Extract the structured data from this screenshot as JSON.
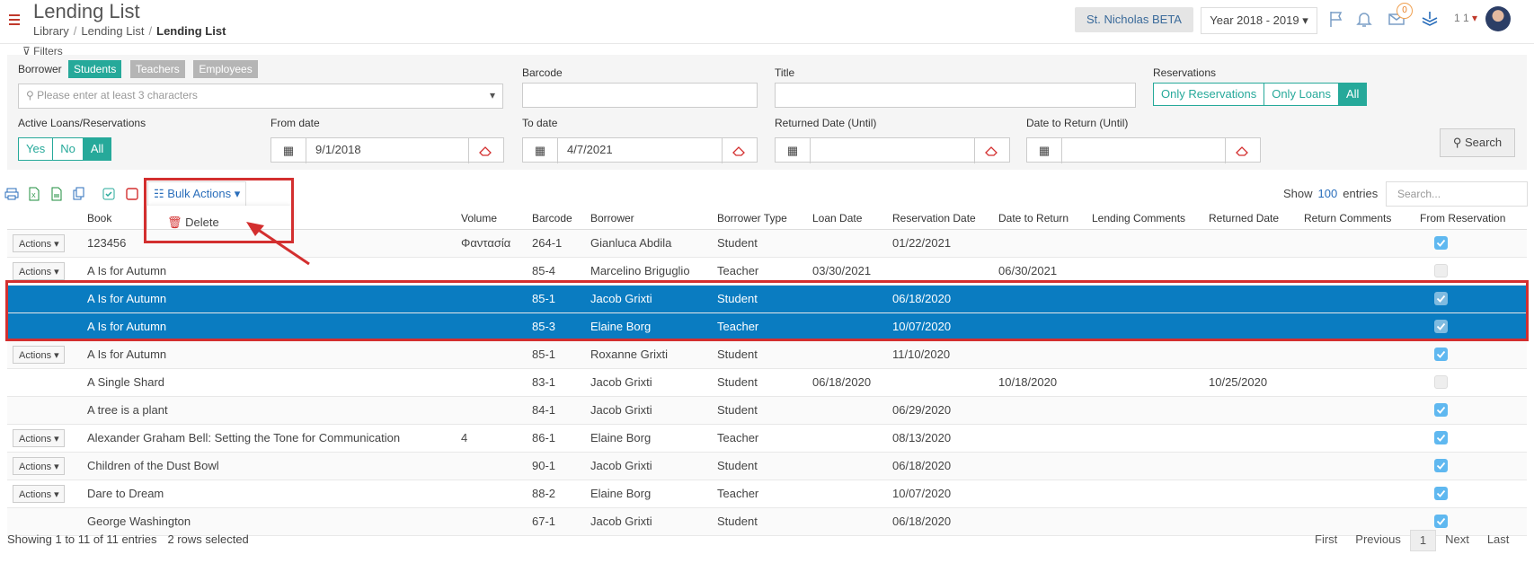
{
  "header": {
    "title": "Lending List",
    "breadcrumb": [
      "Library",
      "Lending List",
      "Lending List"
    ],
    "school": "St. Nicholas BETA",
    "year": "Year 2018 - 2019",
    "notification_count": "0",
    "user": "1 1"
  },
  "filters": {
    "label": "Filters",
    "borrower_label": "Borrower",
    "borrower_types": [
      "Students",
      "Teachers",
      "Employees"
    ],
    "borrower_placeholder": "Please enter at least 3 characters",
    "barcode_label": "Barcode",
    "title_label": "Title",
    "reservations_label": "Reservations",
    "reservations_options": [
      "Only Reservations",
      "Only Loans",
      "All"
    ],
    "active_label": "Active Loans/Reservations",
    "active_options": [
      "Yes",
      "No",
      "All"
    ],
    "from_date_label": "From date",
    "from_date": "9/1/2018",
    "to_date_label": "To date",
    "to_date": "4/7/2021",
    "returned_date_label": "Returned Date (Until)",
    "date_to_return_label": "Date to Return (Until)",
    "search_label": "Search"
  },
  "toolbar": {
    "bulk_label": "Bulk Actions",
    "delete_label": "Delete",
    "show_label": "Show",
    "show_count": "100",
    "entries_label": "entries",
    "search_placeholder": "Search..."
  },
  "table": {
    "columns": [
      "Book",
      "Volume",
      "Barcode",
      "Borrower",
      "Borrower Type",
      "Loan Date",
      "Reservation Date",
      "Date to Return",
      "Lending Comments",
      "Returned Date",
      "Return Comments",
      "From Reservation"
    ],
    "action_label": "Actions",
    "rows": [
      {
        "actions": true,
        "book": "123456",
        "volume": "Φαντασία",
        "barcode": "264-1",
        "borrower": "Gianluca Abdila",
        "type": "Student",
        "loan": "",
        "reservation": "01/22/2021",
        "to_return": "",
        "returned": "",
        "from_res": true,
        "selected": false
      },
      {
        "actions": true,
        "book": "A Is for Autumn",
        "volume": "",
        "barcode": "85-4",
        "borrower": "Marcelino Briguglio",
        "type": "Teacher",
        "loan": "03/30/2021",
        "reservation": "",
        "to_return": "06/30/2021",
        "returned": "",
        "from_res": false,
        "selected": false
      },
      {
        "actions": false,
        "book": "A Is for Autumn",
        "volume": "",
        "barcode": "85-1",
        "borrower": "Jacob Grixti",
        "type": "Student",
        "loan": "",
        "reservation": "06/18/2020",
        "to_return": "",
        "returned": "",
        "from_res": true,
        "selected": true
      },
      {
        "actions": false,
        "book": "A Is for Autumn",
        "volume": "",
        "barcode": "85-3",
        "borrower": "Elaine Borg",
        "type": "Teacher",
        "loan": "",
        "reservation": "10/07/2020",
        "to_return": "",
        "returned": "",
        "from_res": true,
        "selected": true
      },
      {
        "actions": true,
        "book": "A Is for Autumn",
        "volume": "",
        "barcode": "85-1",
        "borrower": "Roxanne Grixti",
        "type": "Student",
        "loan": "",
        "reservation": "11/10/2020",
        "to_return": "",
        "returned": "",
        "from_res": true,
        "selected": false
      },
      {
        "actions": false,
        "book": "A Single Shard",
        "volume": "",
        "barcode": "83-1",
        "borrower": "Jacob Grixti",
        "type": "Student",
        "loan": "06/18/2020",
        "reservation": "",
        "to_return": "10/18/2020",
        "returned": "10/25/2020",
        "from_res": false,
        "selected": false
      },
      {
        "actions": false,
        "book": "A tree is a plant",
        "volume": "",
        "barcode": "84-1",
        "borrower": "Jacob Grixti",
        "type": "Student",
        "loan": "",
        "reservation": "06/29/2020",
        "to_return": "",
        "returned": "",
        "from_res": true,
        "selected": false
      },
      {
        "actions": true,
        "book": "Alexander Graham Bell: Setting the Tone for Communication",
        "volume": "4",
        "barcode": "86-1",
        "borrower": "Elaine Borg",
        "type": "Teacher",
        "loan": "",
        "reservation": "08/13/2020",
        "to_return": "",
        "returned": "",
        "from_res": true,
        "selected": false
      },
      {
        "actions": true,
        "book": "Children of the Dust Bowl",
        "volume": "",
        "barcode": "90-1",
        "borrower": "Jacob Grixti",
        "type": "Student",
        "loan": "",
        "reservation": "06/18/2020",
        "to_return": "",
        "returned": "",
        "from_res": true,
        "selected": false
      },
      {
        "actions": true,
        "book": "Dare to Dream",
        "volume": "",
        "barcode": "88-2",
        "borrower": "Elaine Borg",
        "type": "Teacher",
        "loan": "",
        "reservation": "10/07/2020",
        "to_return": "",
        "returned": "",
        "from_res": true,
        "selected": false
      },
      {
        "actions": false,
        "book": "George Washington",
        "volume": "",
        "barcode": "67-1",
        "borrower": "Jacob Grixti",
        "type": "Student",
        "loan": "",
        "reservation": "06/18/2020",
        "to_return": "",
        "returned": "",
        "from_res": true,
        "selected": false
      }
    ]
  },
  "footer": {
    "info": "Showing 1 to 11 of 11 entries",
    "selected": "2 rows selected",
    "pager": [
      "First",
      "Previous",
      "1",
      "Next",
      "Last"
    ]
  },
  "colors": {
    "accent": "#26a99a",
    "selected_row": "#0a7cc1",
    "annotation": "#d32f2f",
    "link": "#2a6ebb"
  }
}
